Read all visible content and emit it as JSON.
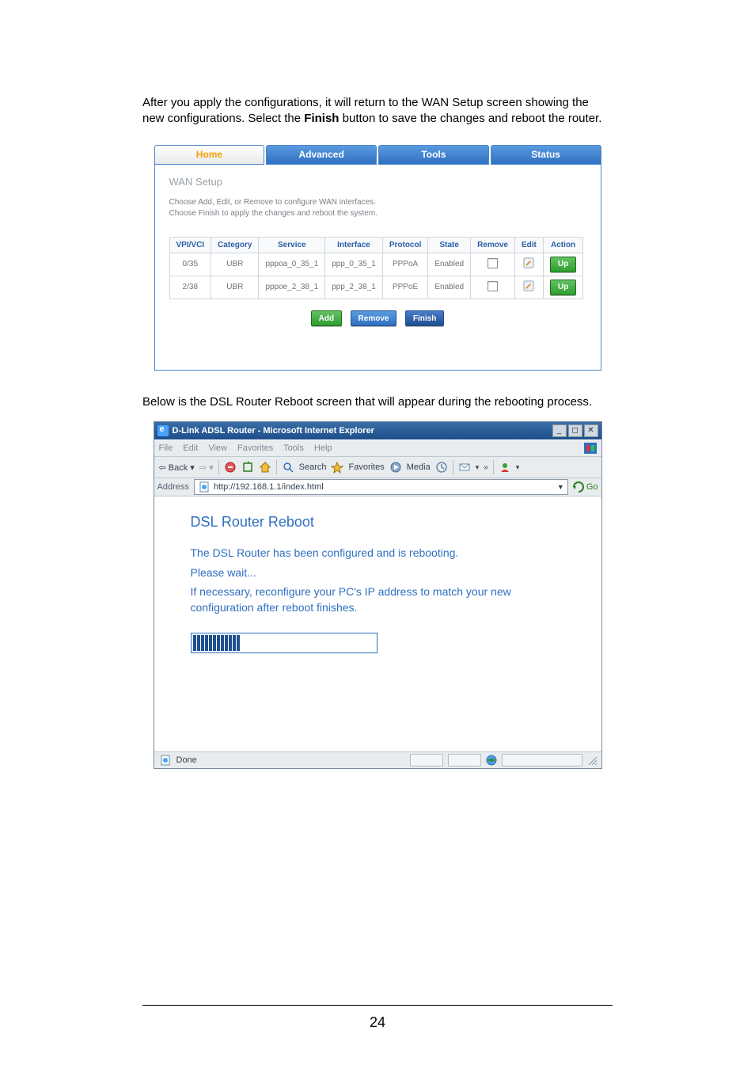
{
  "intro_before_bold": "After you apply the configurations, it will return to the WAN Setup screen showing the new configurations. Select the ",
  "intro_bold": "Finish",
  "intro_after_bold": " button to save the changes and reboot the router.",
  "tabs": {
    "home": "Home",
    "advanced": "Advanced",
    "tools": "Tools",
    "status": "Status"
  },
  "wan": {
    "title": "WAN Setup",
    "desc1": "Choose Add, Edit, or Remove to configure WAN interfaces.",
    "desc2": "Choose Finish to apply the changes and reboot the system.",
    "headers": {
      "vpivci": "VPI/VCI",
      "category": "Category",
      "service": "Service",
      "iface": "Interface",
      "proto": "Protocol",
      "state": "State",
      "remove": "Remove",
      "edit": "Edit",
      "action": "Action"
    },
    "rows": [
      {
        "vpivci": "0/35",
        "category": "UBR",
        "service": "pppoa_0_35_1",
        "iface": "ppp_0_35_1",
        "proto": "PPPoA",
        "state": "Enabled",
        "action": "Up"
      },
      {
        "vpivci": "2/38",
        "category": "UBR",
        "service": "pppoe_2_38_1",
        "iface": "ppp_2_38_1",
        "proto": "PPPoE",
        "state": "Enabled",
        "action": "Up"
      }
    ],
    "btns": {
      "add": "Add",
      "remove": "Remove",
      "finish": "Finish"
    }
  },
  "below": "Below is the DSL Router Reboot screen that will appear during the rebooting process.",
  "ie": {
    "title": "D-Link ADSL Router - Microsoft Internet Explorer",
    "menu": {
      "file": "File",
      "edit": "Edit",
      "view": "View",
      "fav": "Favorites",
      "tools": "Tools",
      "help": "Help"
    },
    "toolbar": {
      "back": "Back",
      "search": "Search",
      "favorites": "Favorites",
      "media": "Media"
    },
    "address_label": "Address",
    "url": "http://192.168.1.1/index.html",
    "go": "Go",
    "heading": "DSL Router Reboot",
    "p1": "The DSL Router has been configured and is rebooting.",
    "p2": "Please wait...",
    "p3": "If necessary, reconfigure your PC's IP address to match your new configuration after reboot finishes.",
    "status": "Done"
  },
  "pagenum": "24"
}
